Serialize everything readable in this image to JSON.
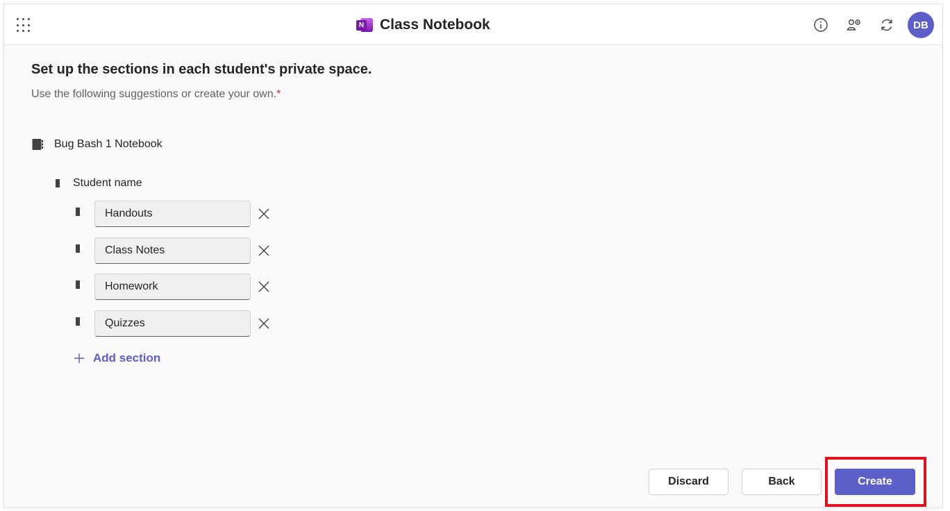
{
  "header": {
    "title": "Class Notebook",
    "logo_letter": "N",
    "avatar_initials": "DB",
    "icons": [
      "waffle-icon",
      "info-icon",
      "people-settings-icon",
      "refresh-icon"
    ]
  },
  "main": {
    "heading": "Set up the sections in each student's private space.",
    "subheading": "Use the following suggestions or create your own.",
    "required_marker": "*",
    "notebook_name": "Bug Bash 1 Notebook",
    "student_group": "Student name",
    "sections": [
      {
        "value": "Handouts"
      },
      {
        "value": "Class Notes"
      },
      {
        "value": "Homework"
      },
      {
        "value": "Quizzes"
      }
    ],
    "add_section_label": "Add section"
  },
  "footer": {
    "discard_label": "Discard",
    "back_label": "Back",
    "create_label": "Create"
  },
  "colors": {
    "accent": "#5b5fc7",
    "highlight": "#e0101c"
  }
}
